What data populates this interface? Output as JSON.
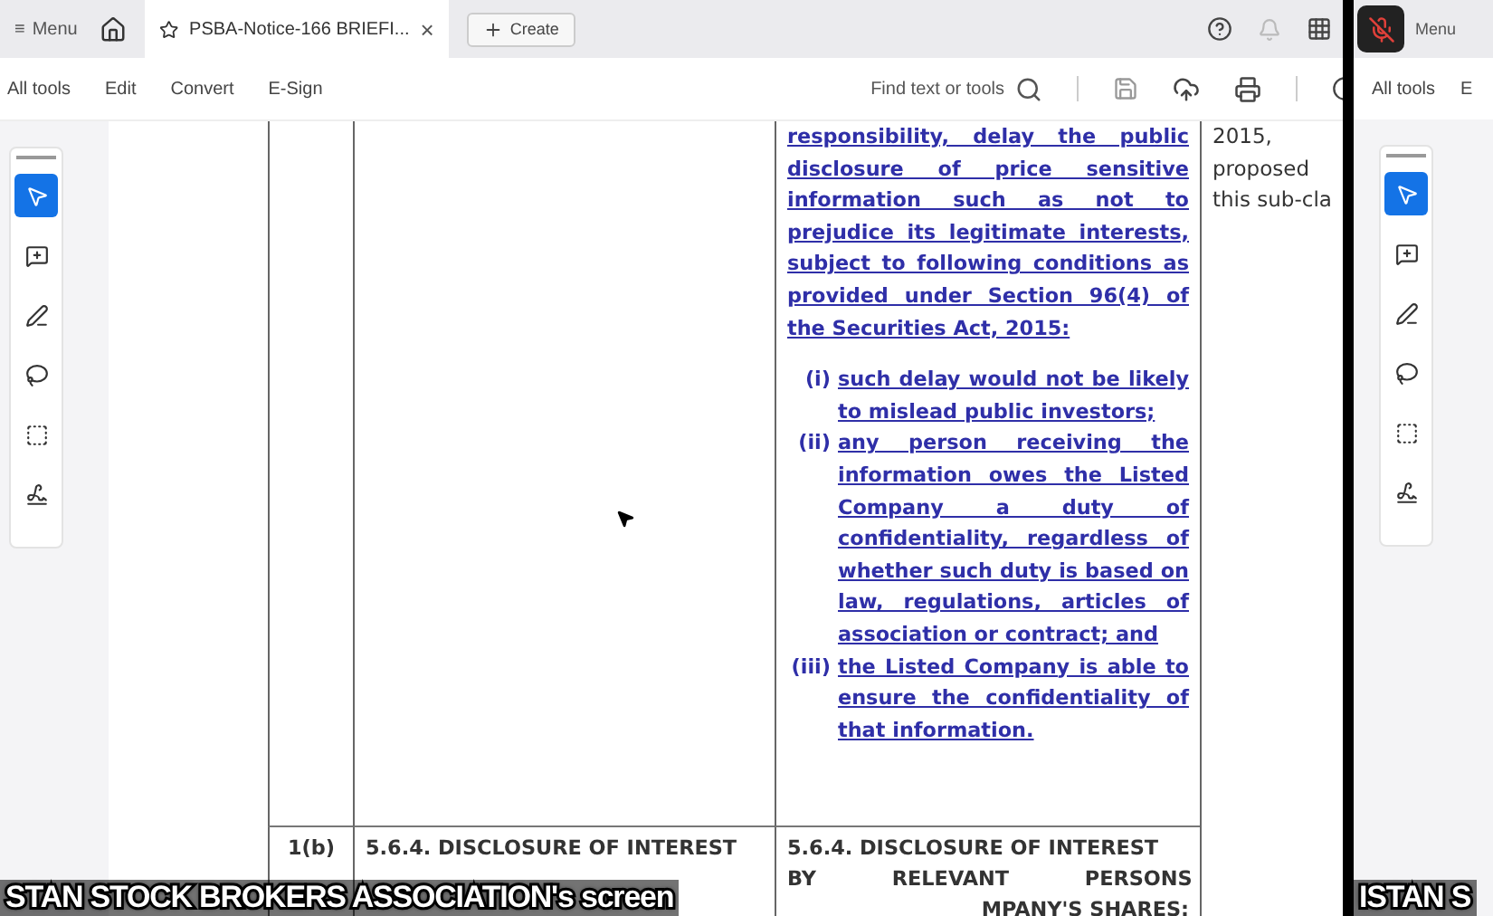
{
  "top_bar": {
    "menu_icon": "≡",
    "menu": "Menu",
    "tab": {
      "title": "PSBA-Notice-166 BRIEFI...",
      "close": "×",
      "selected": true
    },
    "create": "Create"
  },
  "toolbar": {
    "items": [
      {
        "label": "All tools"
      },
      {
        "label": "Edit"
      },
      {
        "label": "Convert"
      },
      {
        "label": "E-Sign"
      }
    ],
    "search": "Find text or tools"
  },
  "tools": [
    {
      "kind": "select",
      "selected": true
    },
    {
      "kind": "comment",
      "selected": false
    },
    {
      "kind": "pen",
      "selected": false
    },
    {
      "kind": "lasso",
      "selected": false
    },
    {
      "kind": "textbox",
      "selected": false
    },
    {
      "kind": "sign",
      "selected": false
    }
  ],
  "document": {
    "rows": [
      {
        "column_1": "",
        "column_3": {
          "intro": "responsibility, delay the public disclosure of price sensitive information such as not to prejudice its legitimate interests, subject to following conditions as provided under Section 96(4) of the Securities Act, 2015:",
          "items": [
            {
              "marker": "(i)",
              "text": "such delay would not be likely to mislead public investors;"
            },
            {
              "marker": "(ii)",
              "text": "any person receiving the information owes the Listed Company a duty of confidentiality, regardless of whether such duty is based on law, regulations, articles of association or contract; and"
            },
            {
              "marker": "(iii)",
              "text": "the Listed Company is able to ensure the confidentiality of that information."
            }
          ]
        },
        "column_4": [
          "2015,",
          "proposed",
          "this sub-cla"
        ]
      },
      {
        "column_1": "1(b)",
        "column_2": "5.6.4. DISCLOSURE OF INTEREST",
        "column_3": {
          "heading": "5.6.4. DISCLOSURE OF INTEREST",
          "lines": [
            "BY RELEVANT PERSONS",
            "MPANY'S SHARES:"
          ]
        }
      }
    ]
  },
  "caption": "STAN STOCK BROKERS ASSOCIATION's screen",
  "side_preview": {
    "menu": "Menu",
    "toolbar": [
      "All tools",
      "E"
    ],
    "caption": "ISTAN S"
  }
}
